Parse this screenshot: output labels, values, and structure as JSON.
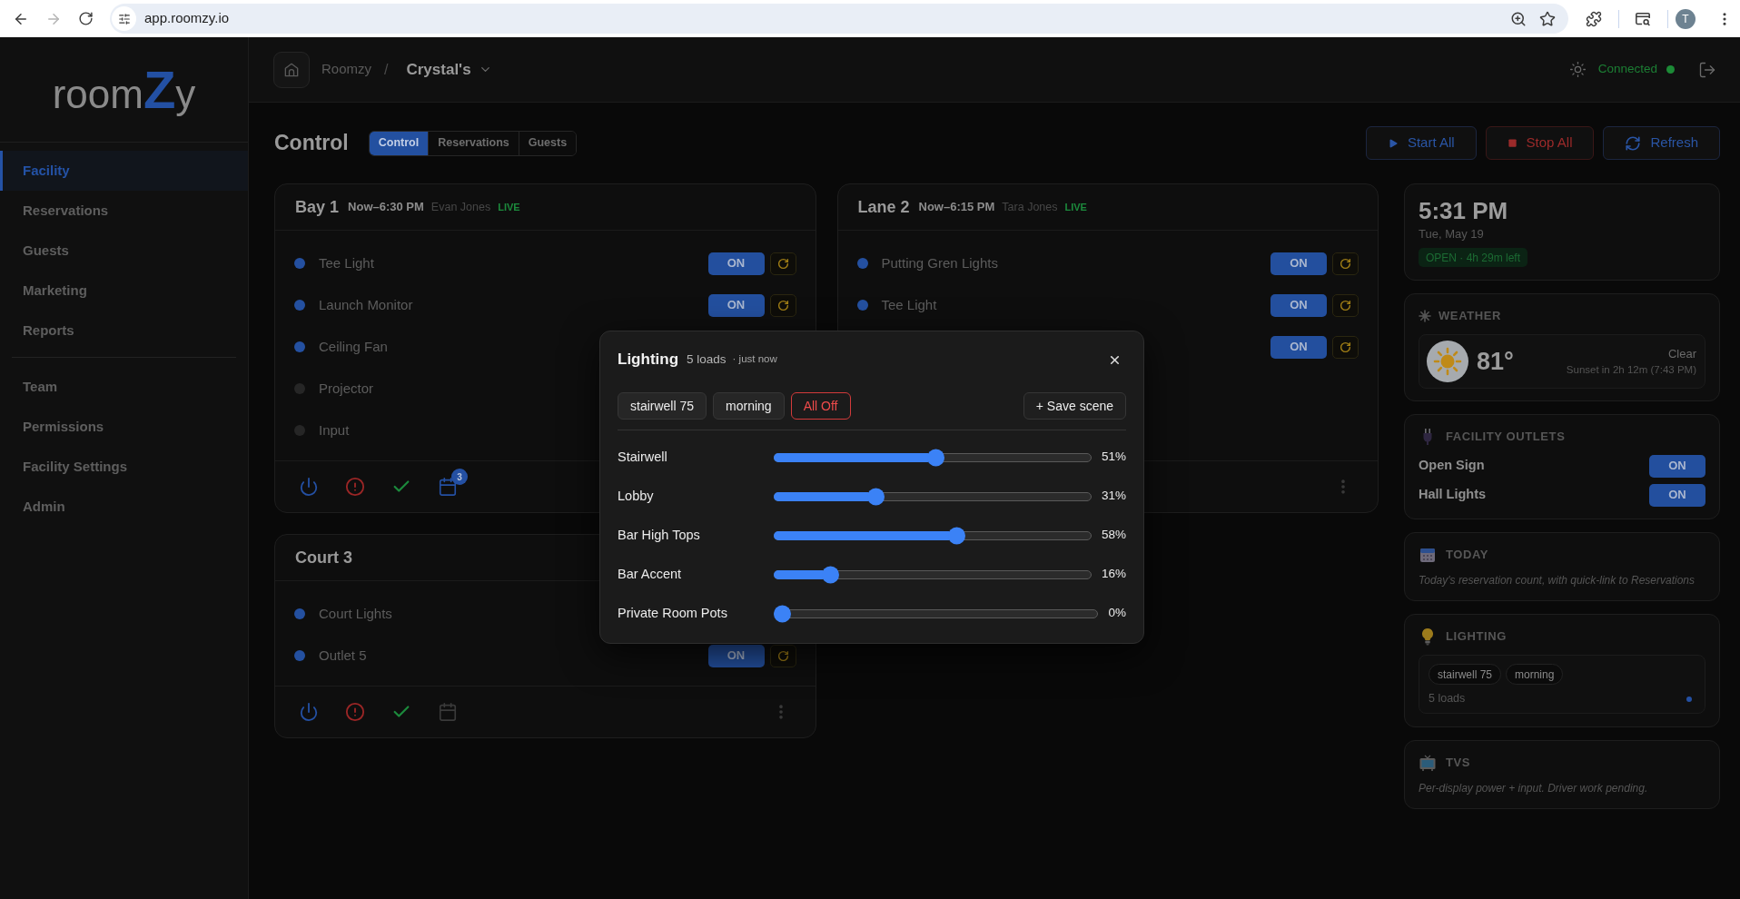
{
  "browser": {
    "url": "app.roomzy.io",
    "back_disabled": false,
    "forward_disabled": true,
    "profile_initial": "T"
  },
  "sidebar": {
    "logo": {
      "start": "room",
      "accent": "Z",
      "end": "y"
    },
    "sections": [
      {
        "items": [
          {
            "label": "Facility",
            "selected": true
          },
          {
            "label": "Reservations",
            "selected": false
          },
          {
            "label": "Guests",
            "selected": false
          },
          {
            "label": "Marketing",
            "selected": false
          },
          {
            "label": "Reports",
            "selected": false
          }
        ]
      },
      {
        "items": [
          {
            "label": "Team",
            "selected": false
          },
          {
            "label": "Permissions",
            "selected": false
          },
          {
            "label": "Facility Settings",
            "selected": false
          },
          {
            "label": "Admin",
            "selected": false
          }
        ]
      }
    ]
  },
  "header": {
    "breadcrumb": "Roomzy",
    "separator": "/",
    "facility": "Crystal's",
    "connection": {
      "label": "Connected",
      "connected": true
    }
  },
  "page": {
    "title": "Control",
    "tabs": [
      {
        "label": "Control",
        "selected": true
      },
      {
        "label": "Reservations",
        "selected": false
      },
      {
        "label": "Guests",
        "selected": false
      }
    ],
    "actions": [
      {
        "kind": "start",
        "label": "Start All"
      },
      {
        "kind": "stop",
        "label": "Stop All"
      },
      {
        "kind": "refresh",
        "label": "Refresh"
      }
    ]
  },
  "rooms": [
    {
      "name": "Bay 1",
      "time": "Now–6:30 PM",
      "guest": "Evan Jones",
      "live_label": "LIVE",
      "rows": [
        {
          "name": "Tee Light",
          "active": true,
          "toggle": {
            "label": "ON",
            "on": true
          }
        },
        {
          "name": "Launch Monitor",
          "active": true,
          "toggle": {
            "label": "ON",
            "on": true
          }
        },
        {
          "name": "Ceiling Fan",
          "active": true
        },
        {
          "name": "Projector",
          "active": false
        },
        {
          "name": "Input",
          "active": false
        }
      ],
      "footer": {
        "tools": [
          {
            "kind": "power"
          },
          {
            "kind": "alert"
          },
          {
            "kind": "confirm"
          },
          {
            "kind": "calendar",
            "badge": "3"
          }
        ]
      }
    },
    {
      "name": "Lane 2",
      "time": "Now–6:15 PM",
      "guest": "Tara Jones",
      "live_label": "LIVE",
      "rows": [
        {
          "name": "Putting Gren Lights",
          "active": true,
          "toggle": {
            "label": "ON",
            "on": true
          }
        },
        {
          "name": "Tee Light",
          "active": true,
          "toggle": {
            "label": "ON",
            "on": true
          }
        },
        {
          "toggle": {
            "label": "ON",
            "on": true
          }
        }
      ],
      "footer": {
        "menu": true
      }
    },
    {
      "name": "Court 3",
      "rows": [
        {
          "name": "Court Lights",
          "active": true
        },
        {
          "name": "Outlet 5",
          "active": true,
          "toggle": {
            "label": "ON",
            "on": true
          }
        }
      ],
      "footer": {
        "tools": [
          {
            "kind": "power"
          },
          {
            "kind": "alert"
          },
          {
            "kind": "confirm"
          },
          {
            "kind": "calendar"
          }
        ],
        "menu": true
      }
    }
  ],
  "widgets": [
    {
      "kind": "clock",
      "time": "5:31 PM",
      "date": "Tue, May 19",
      "status": {
        "label": "OPEN · 4h 29m left",
        "open": true
      }
    },
    {
      "kind": "weather",
      "title": "WEATHER",
      "temperature": "81°",
      "condition": "Clear",
      "sunset": "Sunset in 2h 12m (7:43 PM)"
    },
    {
      "kind": "outlets",
      "title": "FACILITY OUTLETS",
      "items": [
        {
          "name": "Open Sign",
          "toggle": {
            "label": "ON",
            "on": true
          }
        },
        {
          "name": "Hall Lights",
          "toggle": {
            "label": "ON",
            "on": true
          }
        }
      ]
    },
    {
      "kind": "today",
      "title": "TODAY",
      "note": "Today's reservation count, with quick-link to Reservations"
    },
    {
      "kind": "lighting",
      "title": "LIGHTING",
      "scenes": [
        "stairwell 75",
        "morning"
      ],
      "count": "5 loads",
      "active": true
    },
    {
      "kind": "tvs",
      "title": "TVS",
      "note": "Per-display power + input. Driver work pending."
    }
  ],
  "lighting_dialog": {
    "title": "Lighting",
    "count": "5 loads",
    "updated": "· just now",
    "scenes": [
      {
        "label": "stairwell 75",
        "kind": "scene"
      },
      {
        "label": "morning",
        "kind": "scene"
      },
      {
        "label": "All Off",
        "kind": "all_off"
      }
    ],
    "save": "+ Save scene",
    "loads": [
      {
        "name": "Stairwell",
        "level": 0.51,
        "reading": "51%"
      },
      {
        "name": "Lobby",
        "level": 0.31,
        "reading": "31%"
      },
      {
        "name": "Bar High Tops",
        "level": 0.58,
        "reading": "58%"
      },
      {
        "name": "Bar Accent",
        "level": 0.16,
        "reading": "16%"
      },
      {
        "name": "Private Room Pots",
        "level": 0,
        "reading": "0%"
      }
    ]
  }
}
